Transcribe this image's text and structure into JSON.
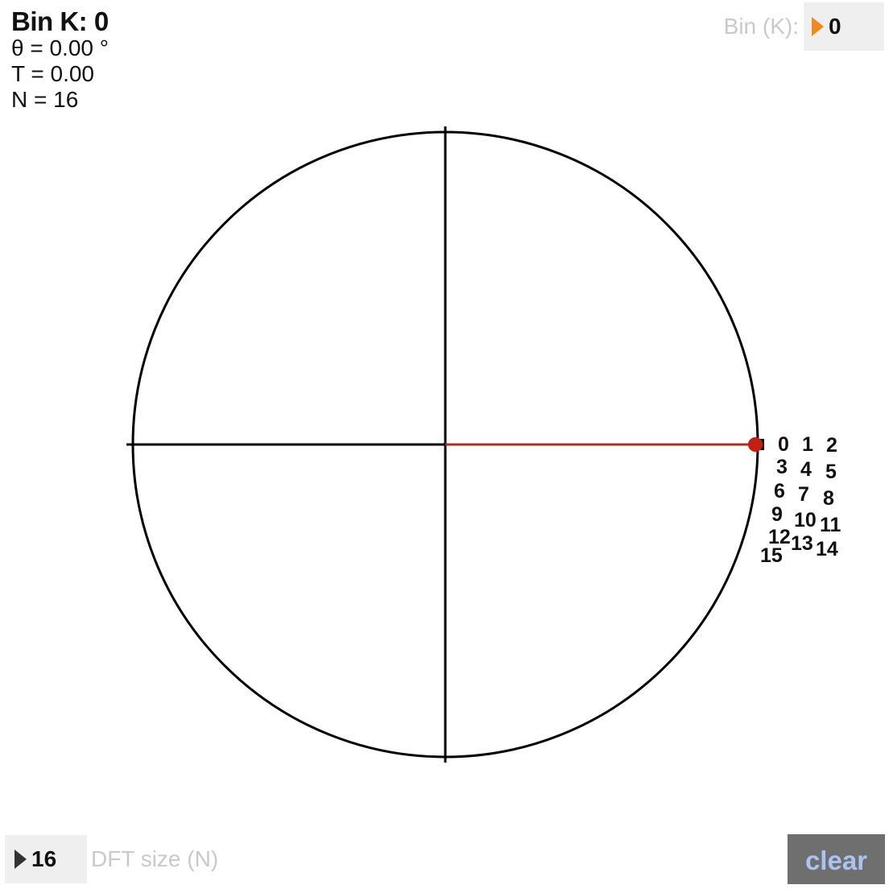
{
  "info": {
    "title": "Bin K: 0",
    "theta": "θ = 0.00 °",
    "t": "T = 0.00",
    "n": "N = 16"
  },
  "bin_control": {
    "label": "Bin (K):",
    "value": "0"
  },
  "n_control": {
    "value": "16",
    "label": "DFT size (N)"
  },
  "clear_button": {
    "label": "clear"
  },
  "bin_labels": [
    "0",
    "1",
    "2",
    "3",
    "4",
    "5",
    "6",
    "7",
    "8",
    "9",
    "10",
    "11",
    "12",
    "13",
    "14",
    "15"
  ],
  "colors": {
    "axis": "#000000",
    "circle": "#000000",
    "vector": "#b22a20",
    "point": "#c41f13",
    "bin_arrow": "#f08a1c",
    "clear_bg": "#6f6f6f",
    "clear_text": "#a9c4f2"
  }
}
